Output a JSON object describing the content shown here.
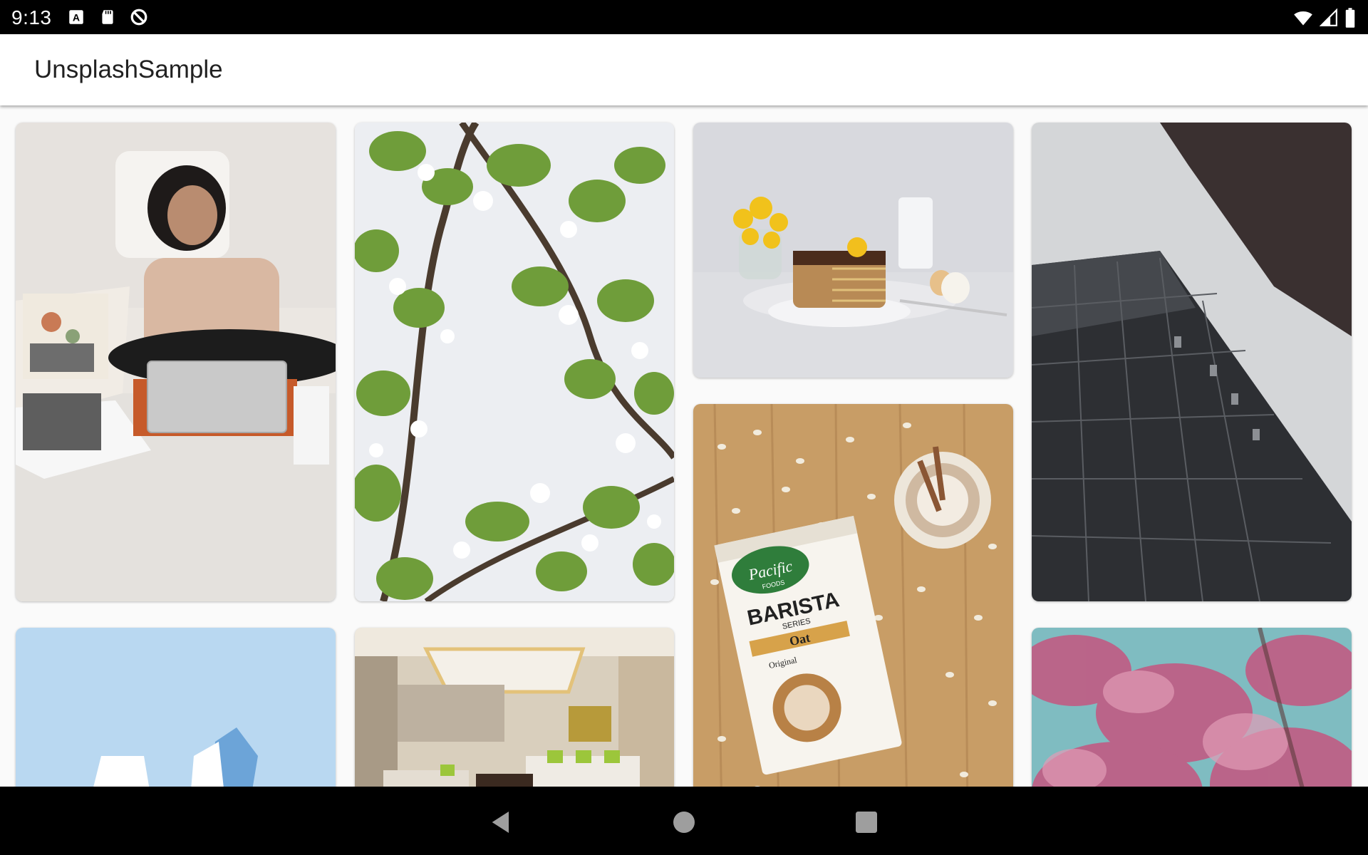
{
  "status_bar": {
    "time": "9:13",
    "left_icons": [
      "keyboard-a-icon",
      "sd-card-icon",
      "data-saver-icon"
    ],
    "right_icons": [
      "wifi-icon",
      "cell-signal-icon",
      "battery-icon"
    ]
  },
  "app_bar": {
    "title": "UnsplashSample"
  },
  "photos": [
    {
      "subject": "woman working on laptop in bed",
      "color": "#e7e2dc"
    },
    {
      "subject": "cherry blossom branches",
      "color": "#d9e8cf"
    },
    {
      "subject": "pancake stack with flowers and milk",
      "color": "#d6d7dc"
    },
    {
      "subject": "skyscrapers looking up",
      "color": "#3a3c40"
    },
    {
      "subject": "oat milk carton with coffee",
      "color": "#c59a63"
    },
    {
      "subject": "blue sky with white building",
      "color": "#b9d6ee"
    },
    {
      "subject": "modern living room interior",
      "color": "#cdbfa6"
    },
    {
      "subject": "pink blossoms blurred",
      "color": "#b96a86"
    }
  ],
  "product_label": {
    "brand": "Pacific",
    "brand_sub": "FOODS",
    "line": "BARISTA",
    "series": "SERIES",
    "flavor": "Oat",
    "variant": "Original"
  },
  "nav_bar": {
    "buttons": [
      "back-icon",
      "home-icon",
      "recents-icon"
    ]
  }
}
